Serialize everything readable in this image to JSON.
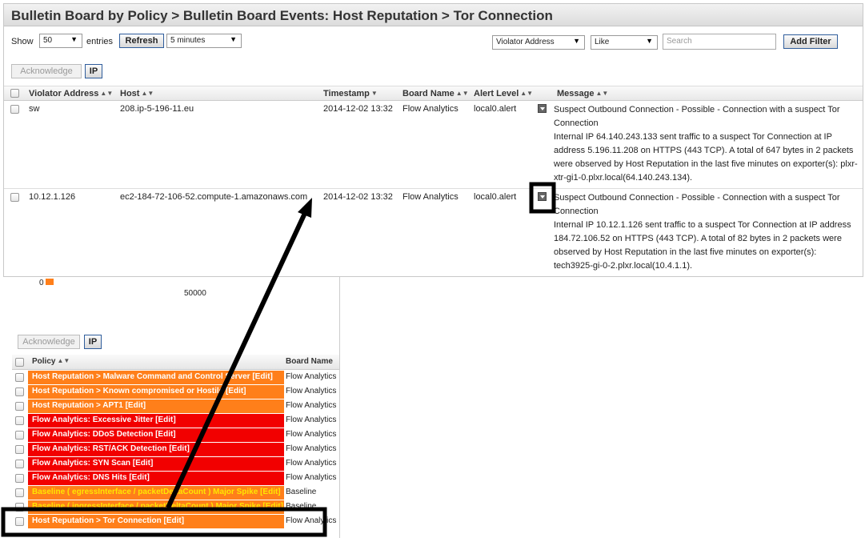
{
  "window_title": "Bulletin Board by Policy > Bulletin Board Events: Host Reputation > Tor Connection",
  "controls": {
    "show_label": "Show",
    "show_value": "50",
    "entries_label": "entries",
    "refresh_label": "Refresh",
    "interval_value": "5 minutes",
    "filter_field": "Violator Address",
    "filter_op": "Like",
    "search_placeholder": "Search",
    "add_filter_label": "Add Filter",
    "acknowledge_label": "Acknowledge",
    "ip_label": "IP"
  },
  "table": {
    "columns": [
      "Violator Address",
      "Host",
      "Timestamp",
      "Board Name",
      "Alert Level",
      "Message"
    ],
    "rows": [
      {
        "violator": "sw",
        "host": "208.ip-5-196-11.eu",
        "timestamp": "2014-12-02 13:32",
        "board": "Flow Analytics",
        "level": "local0.alert",
        "message": "Suspect Outbound Connection - Possible - Connection with a suspect Tor Connection\nInternal IP 64.140.243.133 sent traffic to a suspect Tor Connection at IP address 5.196.11.208 on HTTPS (443 TCP). A total of 647 bytes in 2 packets were observed by Host Reputation in the last five minutes on exporter(s): plxr-xtr-gi1-0.plxr.local(64.140.243.134)."
      },
      {
        "violator": "10.12.1.126",
        "host": "ec2-184-72-106-52.compute-1.amazonaws.com",
        "timestamp": "2014-12-02 13:32",
        "board": "Flow Analytics",
        "level": "local0.alert",
        "message": "Suspect Outbound Connection - Possible - Connection with a suspect Tor Connection\nInternal IP 10.12.1.126 sent traffic to a suspect Tor Connection at IP address 184.72.106.52 on HTTPS (443 TCP). A total of 82 bytes in 2 packets were observed by Host Reputation in the last five minutes on exporter(s): tech3925-gi-0-2.plxr.local(10.4.1.1)."
      }
    ]
  },
  "bottom": {
    "axis_zero": "0",
    "axis_label": "50000",
    "acknowledge_label": "Acknowledge",
    "ip_label": "IP",
    "col_policy": "Policy",
    "col_board": "Board Name",
    "policies": [
      {
        "name": "Host Reputation > Malware Command and Control Server [Edit]",
        "board": "Flow Analytics",
        "color": "orange"
      },
      {
        "name": "Host Reputation > Known compromised or Hostile [Edit]",
        "board": "Flow Analytics",
        "color": "orange"
      },
      {
        "name": "Host Reputation > APT1 [Edit]",
        "board": "Flow Analytics",
        "color": "orange"
      },
      {
        "name": "Flow Analytics: Excessive Jitter [Edit]",
        "board": "Flow Analytics",
        "color": "red"
      },
      {
        "name": "Flow Analytics: DDoS Detection [Edit]",
        "board": "Flow Analytics",
        "color": "red"
      },
      {
        "name": "Flow Analytics: RST/ACK Detection [Edit]",
        "board": "Flow Analytics",
        "color": "red"
      },
      {
        "name": "Flow Analytics: SYN Scan [Edit]",
        "board": "Flow Analytics",
        "color": "red"
      },
      {
        "name": "Flow Analytics: DNS Hits [Edit]",
        "board": "Flow Analytics",
        "color": "red"
      },
      {
        "name": "Baseline ( egressInterface / packetDeltaCount ) Major Spike [Edit]",
        "board": "Baseline",
        "color": "orange-yellow"
      },
      {
        "name": "Baseline ( ingressInterface / packetDeltaCount ) Major Spike [Edit]",
        "board": "Baseline",
        "color": "orange-yellow"
      },
      {
        "name": "Host Reputation > Tor Connection [Edit]",
        "board": "Flow Analytics",
        "color": "orange"
      }
    ]
  },
  "colors": {
    "orange": "#ff7f1a",
    "red": "#f20000",
    "yellow_text": "#ffe600"
  }
}
